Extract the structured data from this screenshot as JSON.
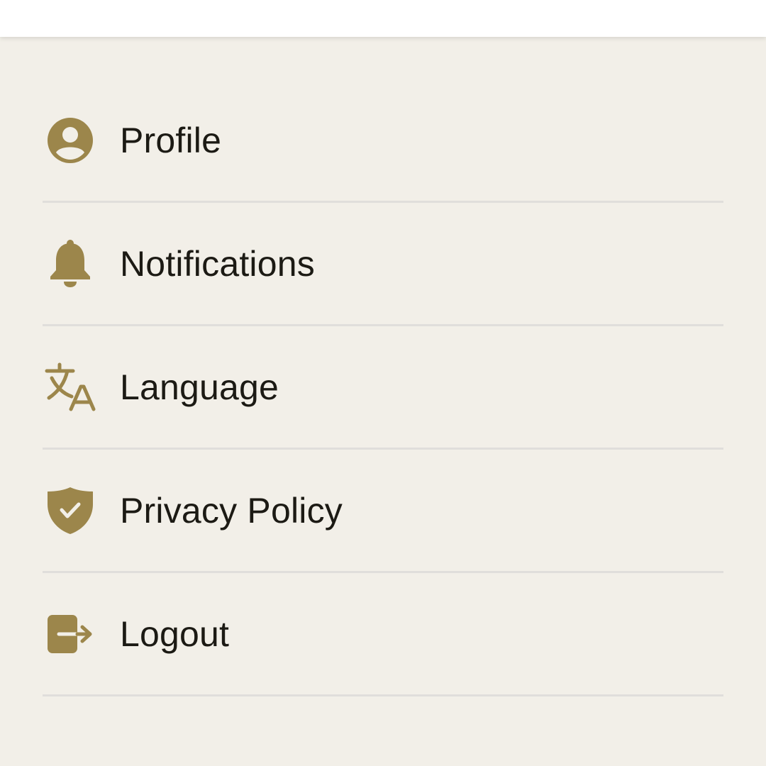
{
  "colors": {
    "accent": "#9c864b",
    "text": "#1c1a14",
    "background": "#f2efe8",
    "divider": "#e0dedb",
    "app_bar": "#ffffff"
  },
  "menu": {
    "items": [
      {
        "label": "Profile",
        "icon": "account-circle-icon"
      },
      {
        "label": "Notifications",
        "icon": "bell-icon"
      },
      {
        "label": "Language",
        "icon": "translate-icon"
      },
      {
        "label": "Privacy Policy",
        "icon": "shield-check-icon"
      },
      {
        "label": "Logout",
        "icon": "logout-icon"
      }
    ]
  }
}
